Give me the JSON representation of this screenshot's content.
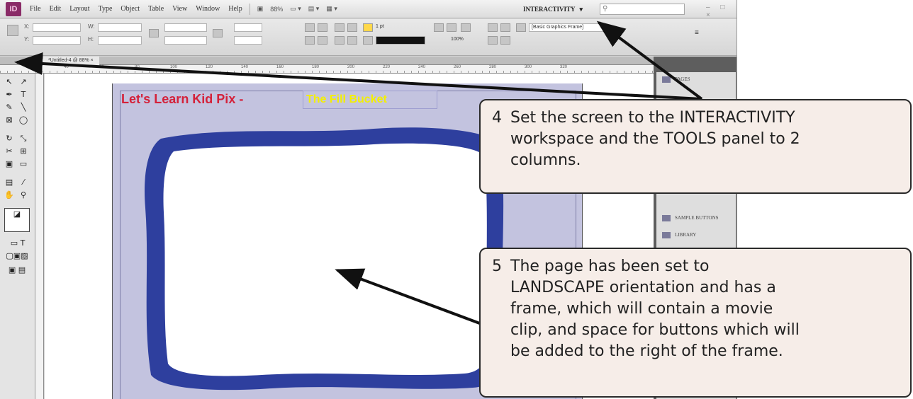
{
  "menubar": {
    "app_logo": "ID",
    "items": [
      "File",
      "Edit",
      "Layout",
      "Type",
      "Object",
      "Table",
      "View",
      "Window",
      "Help"
    ],
    "zoom": "88%",
    "workspace": "INTERACTIVITY",
    "workspace_arrow": "▾",
    "window_controls": "– □ ×"
  },
  "controlbar": {
    "x_label": "X:",
    "y_label": "Y:",
    "w_label": "W:",
    "h_label": "H:",
    "stroke_weight": "1 pt",
    "opacity": "100%",
    "object_style": "[Basic Graphics Frame]"
  },
  "document": {
    "tab_label": "*Untitled-4 @ 88% ×",
    "ruler_marks": [
      "40",
      "60",
      "80",
      "100",
      "120",
      "140",
      "160",
      "180",
      "200",
      "220",
      "240",
      "260",
      "280",
      "300",
      "320"
    ],
    "page_title": "Let's Learn Kid Pix -",
    "title_highlight": "The Fill Bucket"
  },
  "panels": {
    "items": [
      "PAGES",
      "SAMPLE BUTTONS",
      "LIBRARY"
    ]
  },
  "callouts": {
    "step4": {
      "number": "4",
      "line1": "Set the screen to the INTERACTIVITY",
      "line2": "workspace and the TOOLS panel to 2",
      "line3": "columns."
    },
    "step5": {
      "number": "5",
      "line1": "The page has been set to",
      "line2": "LANDSCAPE orientation and has a",
      "line3": "frame, which will contain a movie",
      "line4": "clip, and space for buttons which will",
      "line5": "be added to the right of the frame."
    }
  },
  "colors": {
    "page_background": "#c3c3df",
    "title_red": "#d4213a",
    "title_yellow": "#f4f000",
    "frame_blue": "#2e3f9e",
    "callout_fill": "#f6ede8"
  }
}
